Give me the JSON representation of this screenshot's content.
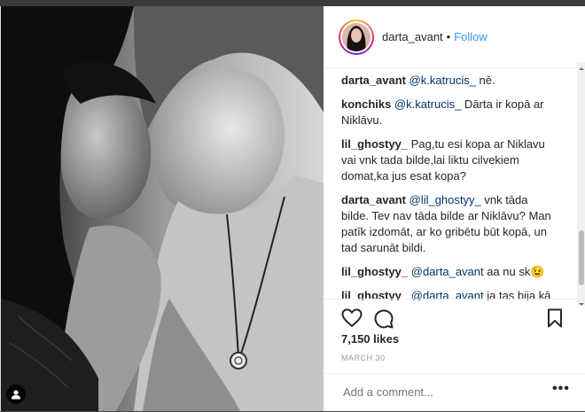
{
  "header": {
    "username": "darta_avant",
    "separator": "•",
    "follow_label": "Follow"
  },
  "comments": [
    {
      "user": "darta_avant",
      "mention": "@k.katrucis_",
      "text": " nē."
    },
    {
      "user": "konchiks",
      "mention": "@k.katrucis_",
      "text": " Dārta ir kopā ar Niklāvu."
    },
    {
      "user": "lil_ghostyy_",
      "mention": "",
      "text": "Pag,tu esi kopa ar Niklavu vai vnk tada bilde,lai liktu cilvekiem domat,ka jus esat kopa?"
    },
    {
      "user": "darta_avant",
      "mention": "@lil_ghostyy_",
      "text": " vnk tāda bilde. Tev nav tāda bilde ar Niklāvu? Man patīk izdomāt, ar ko gribētu būt kopā, un tad sarunāt bildi."
    },
    {
      "user": "lil_ghostyy_",
      "mention": "@darta_avant",
      "text": " aa nu sk😉"
    },
    {
      "user": "lil_ghostyy_",
      "mention": "@darta_avant",
      "text": " ja tas bija kā jautājums ( Vai tev nav tāda bilde ar Niklāvu?),tad man nav...."
    }
  ],
  "likes": "7,150 likes",
  "date": "MARCH 30",
  "add_comment_placeholder": "Add a comment...",
  "more_label": "•••"
}
